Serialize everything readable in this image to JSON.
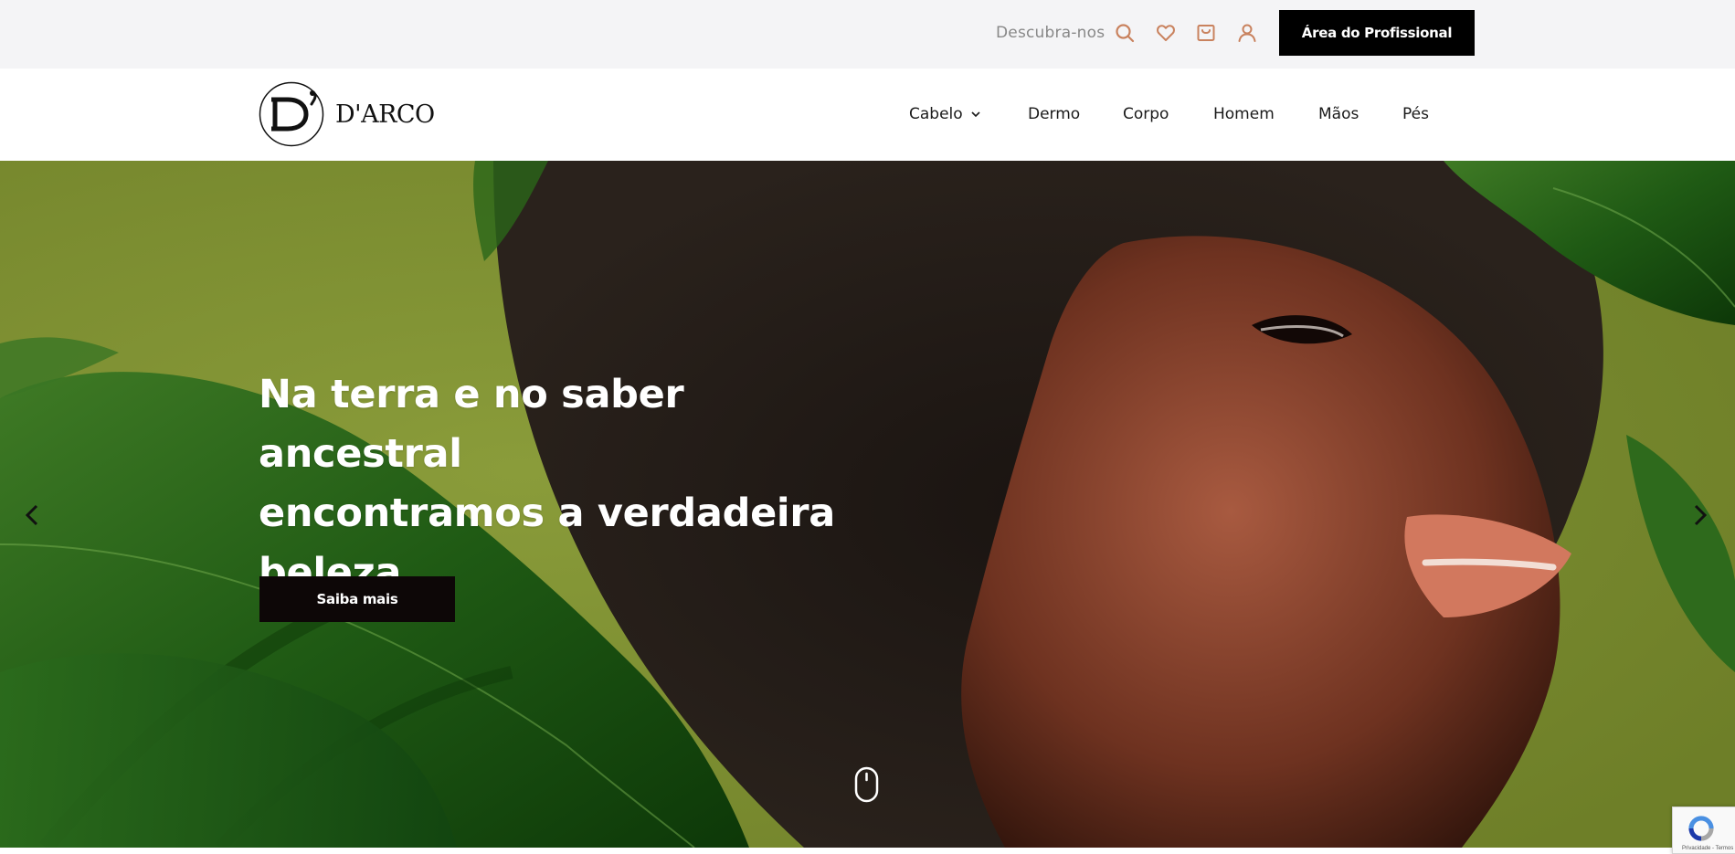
{
  "topbar": {
    "discover_label": "Descubra-nos",
    "icons": [
      "search-icon",
      "heart-icon",
      "bag-icon",
      "user-icon"
    ],
    "pro_button_label": "Área do Profissional"
  },
  "header": {
    "logo_text": "D'ARCO",
    "nav": [
      {
        "label": "Cabelo",
        "has_dropdown": true
      },
      {
        "label": "Dermo"
      },
      {
        "label": "Corpo"
      },
      {
        "label": "Homem"
      },
      {
        "label": "Mãos"
      },
      {
        "label": "Pés"
      }
    ]
  },
  "hero": {
    "headline_line1": "Na terra e no saber ancestral",
    "headline_line2": "encontramos a verdadeira",
    "headline_line3": "beleza.",
    "cta_label": "Saiba mais"
  },
  "recaptcha": {
    "text": "Privacidade - Termos"
  },
  "colors": {
    "accent": "#c9825e",
    "hero_bg": "#7a8c2e",
    "button_bg": "#000000"
  }
}
